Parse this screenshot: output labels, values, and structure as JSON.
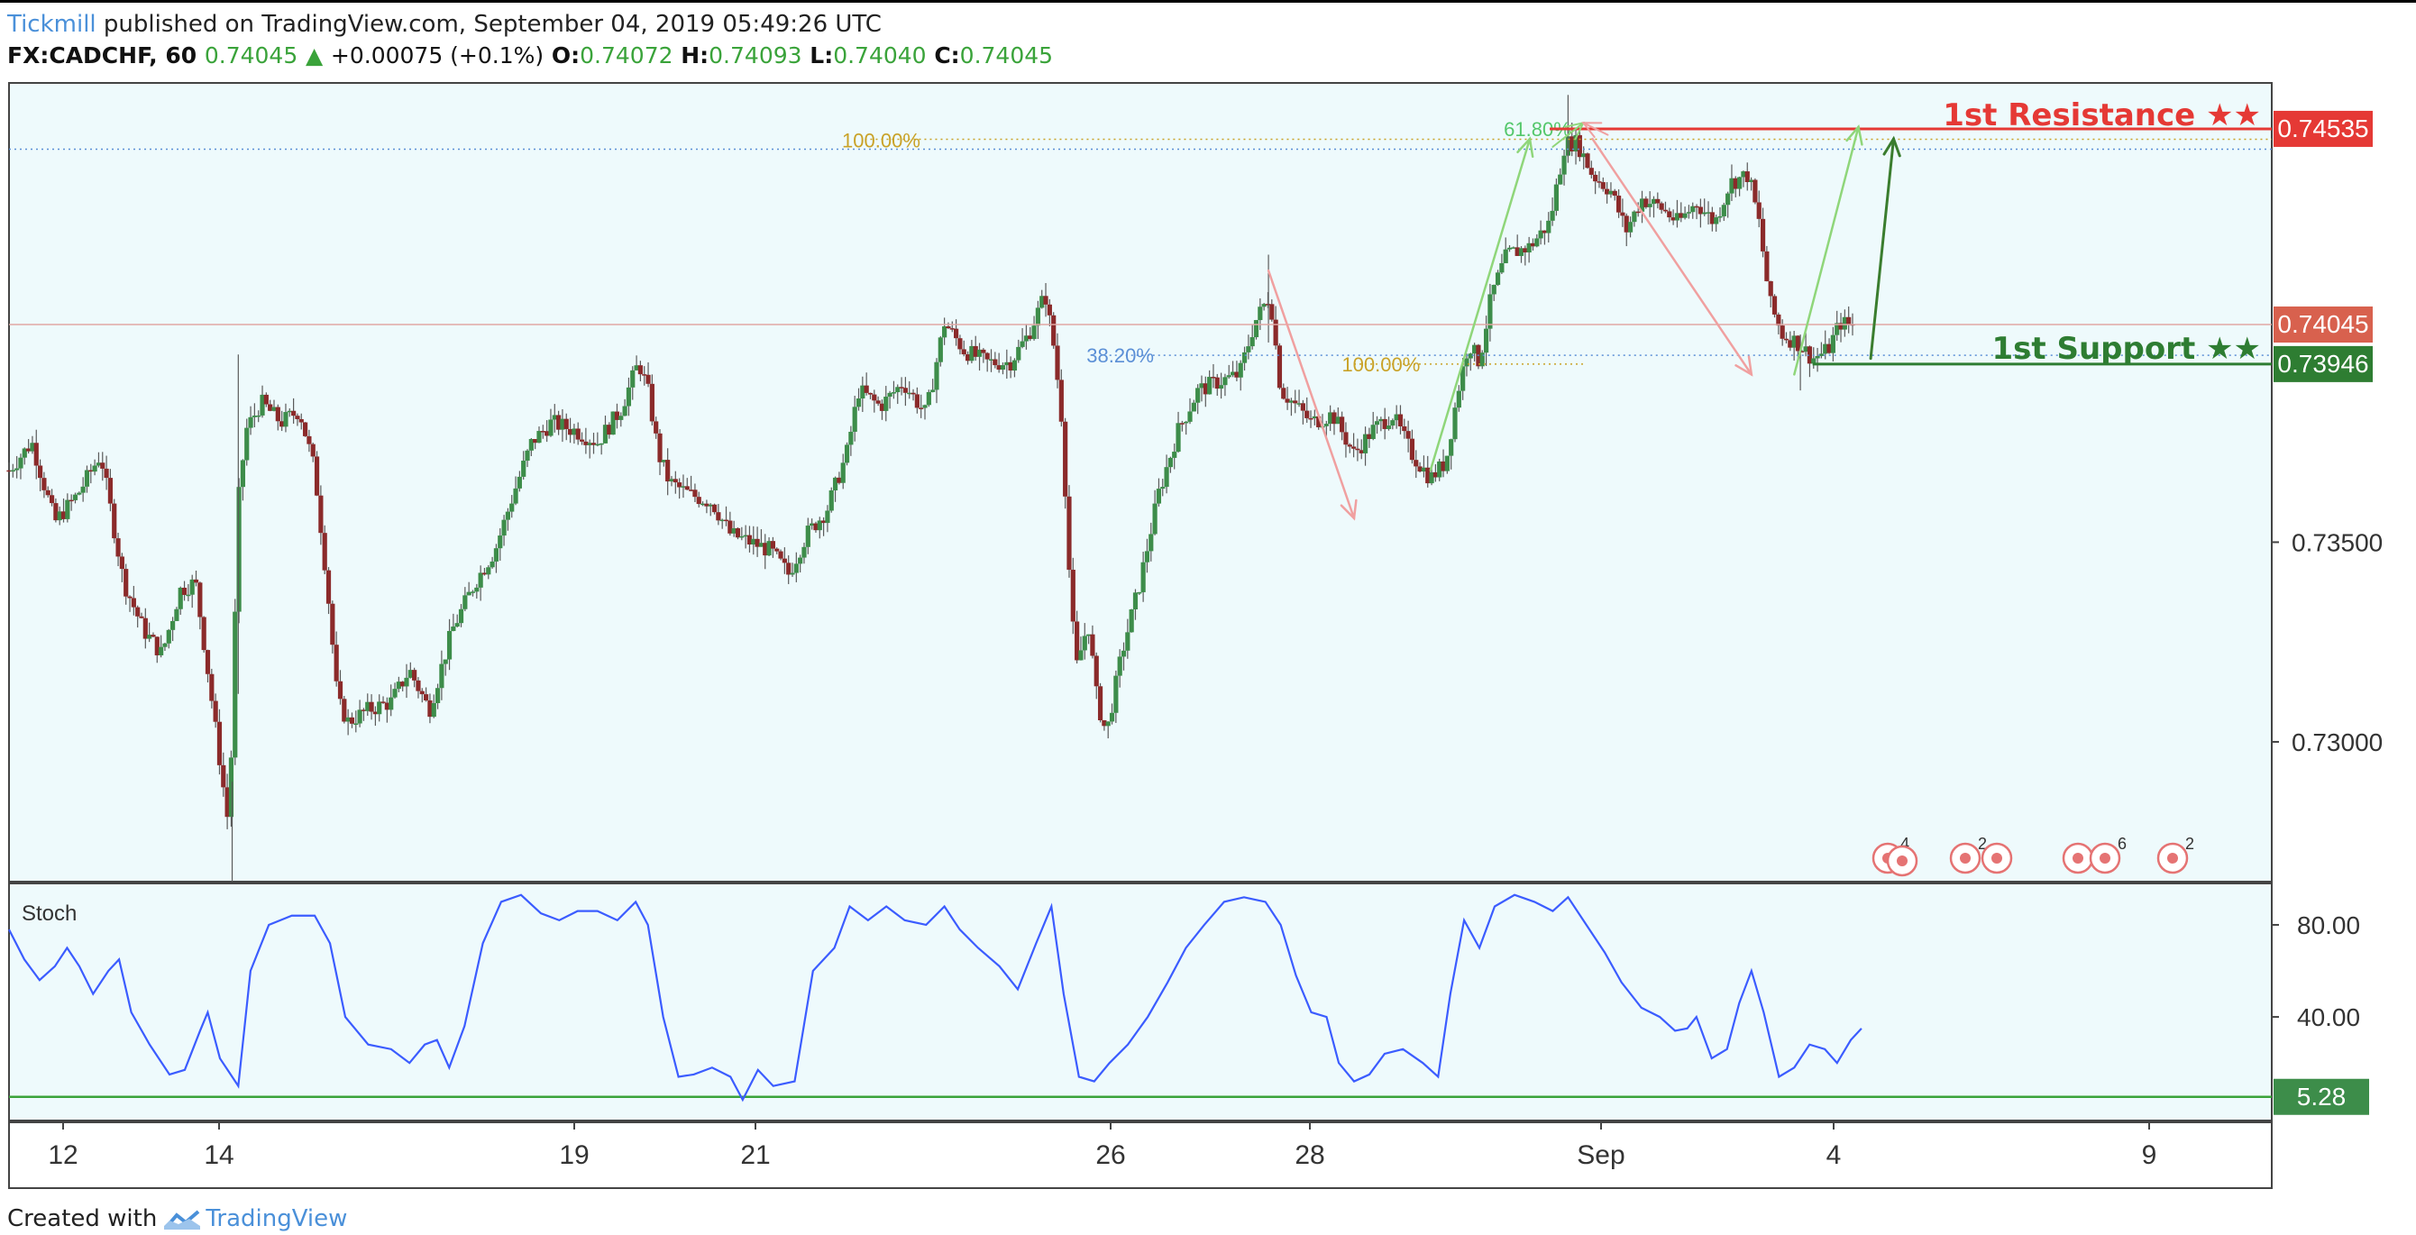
{
  "header": {
    "brand": "Tickmill",
    "published": "published on TradingView.com, September 04, 2019 05:49:26 UTC",
    "symbol": "FX:CADCHF, 60",
    "last": "0.74045",
    "change": "+0.00075 (+0.1%)",
    "o_label": "O:",
    "o_value": "0.74072",
    "h_label": "H:",
    "h_value": "0.74093",
    "l_label": "L:",
    "l_value": "0.74040",
    "c_label": "C:",
    "c_value": "0.74045"
  },
  "footer": {
    "created": "Created with",
    "tv": "TradingView"
  },
  "colors": {
    "panel_bg": "#eefafc",
    "bull": "#3d8d4a",
    "bear": "#8b2a2a",
    "resistance": "#e53935",
    "support": "#2e7d32",
    "stoch_line": "#3b5cff",
    "fib_gold": "#c9a227",
    "fib_blue": "#5b8fd6",
    "fib_green": "#54c76b"
  },
  "chart_data": [
    {
      "type": "candlestick",
      "title": "FX:CADCHF, 60",
      "x_ticks": [
        "12",
        "14",
        "19",
        "21",
        "26",
        "28",
        "Sep",
        "4",
        "9"
      ],
      "y_ticks": [
        "0.73000",
        "0.73500"
      ],
      "ylim": [
        0.7265,
        0.7465
      ],
      "price_path": [
        [
          0,
          0.7368
        ],
        [
          15,
          0.7375
        ],
        [
          30,
          0.7355
        ],
        [
          45,
          0.7362
        ],
        [
          60,
          0.7372
        ],
        [
          75,
          0.734
        ],
        [
          88,
          0.7328
        ],
        [
          100,
          0.7322
        ],
        [
          112,
          0.7338
        ],
        [
          122,
          0.734
        ],
        [
          130,
          0.7318
        ],
        [
          138,
          0.7295
        ],
        [
          144,
          0.7278
        ],
        [
          150,
          0.736
        ],
        [
          155,
          0.7378
        ],
        [
          165,
          0.7385
        ],
        [
          178,
          0.738
        ],
        [
          190,
          0.7383
        ],
        [
          200,
          0.7368
        ],
        [
          208,
          0.734
        ],
        [
          215,
          0.731
        ],
        [
          222,
          0.7305
        ],
        [
          235,
          0.7308
        ],
        [
          250,
          0.731
        ],
        [
          262,
          0.7318
        ],
        [
          275,
          0.7308
        ],
        [
          290,
          0.7328
        ],
        [
          305,
          0.734
        ],
        [
          318,
          0.7348
        ],
        [
          330,
          0.7362
        ],
        [
          342,
          0.7375
        ],
        [
          355,
          0.738
        ],
        [
          370,
          0.7378
        ],
        [
          385,
          0.7375
        ],
        [
          400,
          0.7383
        ],
        [
          412,
          0.7395
        ],
        [
          418,
          0.7388
        ],
        [
          425,
          0.7372
        ],
        [
          432,
          0.7365
        ],
        [
          445,
          0.7362
        ],
        [
          460,
          0.736
        ],
        [
          472,
          0.7352
        ],
        [
          485,
          0.735
        ],
        [
          498,
          0.7348
        ],
        [
          510,
          0.7342
        ],
        [
          522,
          0.7352
        ],
        [
          535,
          0.7358
        ],
        [
          548,
          0.7372
        ],
        [
          556,
          0.7388
        ],
        [
          570,
          0.7384
        ],
        [
          585,
          0.739
        ],
        [
          600,
          0.7382
        ],
        [
          612,
          0.7405
        ],
        [
          625,
          0.7398
        ],
        [
          640,
          0.7395
        ],
        [
          655,
          0.7395
        ],
        [
          667,
          0.7402
        ],
        [
          678,
          0.7412
        ],
        [
          684,
          0.7398
        ],
        [
          689,
          0.738
        ],
        [
          694,
          0.734
        ],
        [
          698,
          0.7318
        ],
        [
          706,
          0.733
        ],
        [
          712,
          0.731
        ],
        [
          718,
          0.7302
        ],
        [
          728,
          0.7322
        ],
        [
          740,
          0.734
        ],
        [
          752,
          0.7362
        ],
        [
          765,
          0.7378
        ],
        [
          778,
          0.7388
        ],
        [
          790,
          0.739
        ],
        [
          805,
          0.7392
        ],
        [
          815,
          0.7405
        ],
        [
          825,
          0.7412
        ],
        [
          832,
          0.7388
        ],
        [
          840,
          0.7385
        ],
        [
          852,
          0.738
        ],
        [
          866,
          0.7382
        ],
        [
          880,
          0.7372
        ],
        [
          892,
          0.7378
        ],
        [
          905,
          0.7382
        ],
        [
          918,
          0.7372
        ],
        [
          930,
          0.7366
        ],
        [
          940,
          0.737
        ],
        [
          948,
          0.7388
        ],
        [
          955,
          0.74
        ],
        [
          962,
          0.7395
        ],
        [
          970,
          0.7412
        ],
        [
          980,
          0.7422
        ],
        [
          995,
          0.7424
        ],
        [
          1008,
          0.743
        ],
        [
          1018,
          0.745
        ],
        [
          1026,
          0.745
        ],
        [
          1036,
          0.7442
        ],
        [
          1048,
          0.7438
        ],
        [
          1058,
          0.7428
        ],
        [
          1068,
          0.7436
        ],
        [
          1080,
          0.7434
        ],
        [
          1092,
          0.743
        ],
        [
          1104,
          0.7435
        ],
        [
          1116,
          0.743
        ],
        [
          1126,
          0.744
        ],
        [
          1138,
          0.7442
        ],
        [
          1145,
          0.743
        ],
        [
          1152,
          0.741
        ],
        [
          1160,
          0.7402
        ],
        [
          1170,
          0.74
        ],
        [
          1180,
          0.7396
        ],
        [
          1190,
          0.7398
        ],
        [
          1198,
          0.7405
        ],
        [
          1208,
          0.7404
        ]
      ],
      "annotations": {
        "resistance": {
          "value": "0.74535",
          "label": "1st Resistance ★★"
        },
        "support": {
          "value": "0.73946",
          "label": "1st Support ★★"
        },
        "current": {
          "value": "0.74045"
        },
        "fib_labels": [
          "100.00%",
          "61.80%",
          "38.20%",
          "100.00%"
        ]
      }
    },
    {
      "type": "line",
      "title": "Stoch",
      "y_ticks": [
        "80.00",
        "40.00"
      ],
      "ylim": [
        -5,
        98
      ],
      "level": {
        "value": "5.28"
      },
      "series": [
        {
          "values": [
            [
              0,
              78
            ],
            [
              10,
              65
            ],
            [
              20,
              56
            ],
            [
              30,
              62
            ],
            [
              38,
              70
            ],
            [
              46,
              62
            ],
            [
              55,
              50
            ],
            [
              65,
              60
            ],
            [
              72,
              65
            ],
            [
              80,
              42
            ],
            [
              92,
              28
            ],
            [
              105,
              15
            ],
            [
              115,
              17
            ],
            [
              125,
              34
            ],
            [
              130,
              42
            ],
            [
              138,
              22
            ],
            [
              150,
              10
            ],
            [
              158,
              60
            ],
            [
              170,
              80
            ],
            [
              185,
              84
            ],
            [
              200,
              84
            ],
            [
              210,
              72
            ],
            [
              220,
              40
            ],
            [
              235,
              28
            ],
            [
              250,
              26
            ],
            [
              262,
              20
            ],
            [
              272,
              28
            ],
            [
              280,
              30
            ],
            [
              288,
              18
            ],
            [
              298,
              36
            ],
            [
              310,
              72
            ],
            [
              322,
              90
            ],
            [
              335,
              93
            ],
            [
              348,
              85
            ],
            [
              360,
              82
            ],
            [
              372,
              86
            ],
            [
              385,
              86
            ],
            [
              398,
              82
            ],
            [
              410,
              90
            ],
            [
              418,
              80
            ],
            [
              428,
              40
            ],
            [
              438,
              14
            ],
            [
              448,
              15
            ],
            [
              460,
              18
            ],
            [
              472,
              14
            ],
            [
              480,
              4
            ],
            [
              490,
              17
            ],
            [
              500,
              10
            ],
            [
              514,
              12
            ],
            [
              526,
              60
            ],
            [
              540,
              70
            ],
            [
              550,
              88
            ],
            [
              562,
              82
            ],
            [
              574,
              88
            ],
            [
              586,
              82
            ],
            [
              600,
              80
            ],
            [
              612,
              88
            ],
            [
              622,
              78
            ],
            [
              634,
              70
            ],
            [
              648,
              62
            ],
            [
              660,
              52
            ],
            [
              672,
              72
            ],
            [
              682,
              88
            ],
            [
              690,
              50
            ],
            [
              700,
              14
            ],
            [
              710,
              12
            ],
            [
              720,
              20
            ],
            [
              732,
              28
            ],
            [
              745,
              40
            ],
            [
              758,
              55
            ],
            [
              770,
              70
            ],
            [
              782,
              80
            ],
            [
              795,
              90
            ],
            [
              808,
              92
            ],
            [
              822,
              90
            ],
            [
              832,
              80
            ],
            [
              842,
              58
            ],
            [
              852,
              42
            ],
            [
              862,
              40
            ],
            [
              870,
              20
            ],
            [
              880,
              12
            ],
            [
              890,
              15
            ],
            [
              900,
              24
            ],
            [
              912,
              26
            ],
            [
              925,
              20
            ],
            [
              935,
              14
            ],
            [
              943,
              50
            ],
            [
              952,
              82
            ],
            [
              962,
              70
            ],
            [
              972,
              88
            ],
            [
              985,
              93
            ],
            [
              998,
              90
            ],
            [
              1010,
              86
            ],
            [
              1020,
              92
            ],
            [
              1032,
              80
            ],
            [
              1044,
              68
            ],
            [
              1055,
              55
            ],
            [
              1068,
              44
            ],
            [
              1080,
              40
            ],
            [
              1090,
              34
            ],
            [
              1098,
              35
            ],
            [
              1104,
              40
            ],
            [
              1114,
              22
            ],
            [
              1124,
              26
            ],
            [
              1132,
              46
            ],
            [
              1140,
              60
            ],
            [
              1148,
              42
            ],
            [
              1158,
              14
            ],
            [
              1168,
              18
            ],
            [
              1178,
              28
            ],
            [
              1188,
              26
            ],
            [
              1196,
              20
            ],
            [
              1205,
              30
            ],
            [
              1212,
              35
            ]
          ]
        }
      ]
    }
  ]
}
